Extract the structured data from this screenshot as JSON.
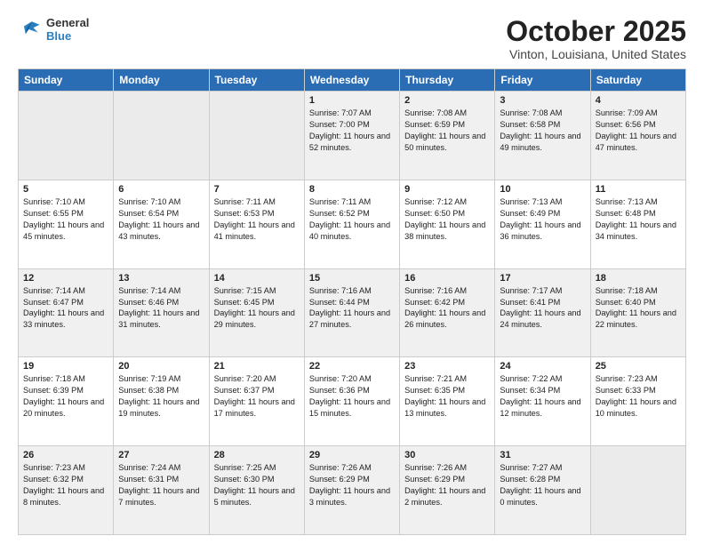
{
  "header": {
    "logo_line1": "General",
    "logo_line2": "Blue",
    "month_title": "October 2025",
    "location": "Vinton, Louisiana, United States"
  },
  "days_of_week": [
    "Sunday",
    "Monday",
    "Tuesday",
    "Wednesday",
    "Thursday",
    "Friday",
    "Saturday"
  ],
  "weeks": [
    [
      {
        "day": "",
        "empty": true
      },
      {
        "day": "",
        "empty": true
      },
      {
        "day": "",
        "empty": true
      },
      {
        "day": "1",
        "sunrise": "7:07 AM",
        "sunset": "7:00 PM",
        "daylight": "11 hours and 52 minutes."
      },
      {
        "day": "2",
        "sunrise": "7:08 AM",
        "sunset": "6:59 PM",
        "daylight": "11 hours and 50 minutes."
      },
      {
        "day": "3",
        "sunrise": "7:08 AM",
        "sunset": "6:58 PM",
        "daylight": "11 hours and 49 minutes."
      },
      {
        "day": "4",
        "sunrise": "7:09 AM",
        "sunset": "6:56 PM",
        "daylight": "11 hours and 47 minutes."
      }
    ],
    [
      {
        "day": "5",
        "sunrise": "7:10 AM",
        "sunset": "6:55 PM",
        "daylight": "11 hours and 45 minutes."
      },
      {
        "day": "6",
        "sunrise": "7:10 AM",
        "sunset": "6:54 PM",
        "daylight": "11 hours and 43 minutes."
      },
      {
        "day": "7",
        "sunrise": "7:11 AM",
        "sunset": "6:53 PM",
        "daylight": "11 hours and 41 minutes."
      },
      {
        "day": "8",
        "sunrise": "7:11 AM",
        "sunset": "6:52 PM",
        "daylight": "11 hours and 40 minutes."
      },
      {
        "day": "9",
        "sunrise": "7:12 AM",
        "sunset": "6:50 PM",
        "daylight": "11 hours and 38 minutes."
      },
      {
        "day": "10",
        "sunrise": "7:13 AM",
        "sunset": "6:49 PM",
        "daylight": "11 hours and 36 minutes."
      },
      {
        "day": "11",
        "sunrise": "7:13 AM",
        "sunset": "6:48 PM",
        "daylight": "11 hours and 34 minutes."
      }
    ],
    [
      {
        "day": "12",
        "sunrise": "7:14 AM",
        "sunset": "6:47 PM",
        "daylight": "11 hours and 33 minutes."
      },
      {
        "day": "13",
        "sunrise": "7:14 AM",
        "sunset": "6:46 PM",
        "daylight": "11 hours and 31 minutes."
      },
      {
        "day": "14",
        "sunrise": "7:15 AM",
        "sunset": "6:45 PM",
        "daylight": "11 hours and 29 minutes."
      },
      {
        "day": "15",
        "sunrise": "7:16 AM",
        "sunset": "6:44 PM",
        "daylight": "11 hours and 27 minutes."
      },
      {
        "day": "16",
        "sunrise": "7:16 AM",
        "sunset": "6:42 PM",
        "daylight": "11 hours and 26 minutes."
      },
      {
        "day": "17",
        "sunrise": "7:17 AM",
        "sunset": "6:41 PM",
        "daylight": "11 hours and 24 minutes."
      },
      {
        "day": "18",
        "sunrise": "7:18 AM",
        "sunset": "6:40 PM",
        "daylight": "11 hours and 22 minutes."
      }
    ],
    [
      {
        "day": "19",
        "sunrise": "7:18 AM",
        "sunset": "6:39 PM",
        "daylight": "11 hours and 20 minutes."
      },
      {
        "day": "20",
        "sunrise": "7:19 AM",
        "sunset": "6:38 PM",
        "daylight": "11 hours and 19 minutes."
      },
      {
        "day": "21",
        "sunrise": "7:20 AM",
        "sunset": "6:37 PM",
        "daylight": "11 hours and 17 minutes."
      },
      {
        "day": "22",
        "sunrise": "7:20 AM",
        "sunset": "6:36 PM",
        "daylight": "11 hours and 15 minutes."
      },
      {
        "day": "23",
        "sunrise": "7:21 AM",
        "sunset": "6:35 PM",
        "daylight": "11 hours and 13 minutes."
      },
      {
        "day": "24",
        "sunrise": "7:22 AM",
        "sunset": "6:34 PM",
        "daylight": "11 hours and 12 minutes."
      },
      {
        "day": "25",
        "sunrise": "7:23 AM",
        "sunset": "6:33 PM",
        "daylight": "11 hours and 10 minutes."
      }
    ],
    [
      {
        "day": "26",
        "sunrise": "7:23 AM",
        "sunset": "6:32 PM",
        "daylight": "11 hours and 8 minutes."
      },
      {
        "day": "27",
        "sunrise": "7:24 AM",
        "sunset": "6:31 PM",
        "daylight": "11 hours and 7 minutes."
      },
      {
        "day": "28",
        "sunrise": "7:25 AM",
        "sunset": "6:30 PM",
        "daylight": "11 hours and 5 minutes."
      },
      {
        "day": "29",
        "sunrise": "7:26 AM",
        "sunset": "6:29 PM",
        "daylight": "11 hours and 3 minutes."
      },
      {
        "day": "30",
        "sunrise": "7:26 AM",
        "sunset": "6:29 PM",
        "daylight": "11 hours and 2 minutes."
      },
      {
        "day": "31",
        "sunrise": "7:27 AM",
        "sunset": "6:28 PM",
        "daylight": "11 hours and 0 minutes."
      },
      {
        "day": "",
        "empty": true
      }
    ]
  ]
}
